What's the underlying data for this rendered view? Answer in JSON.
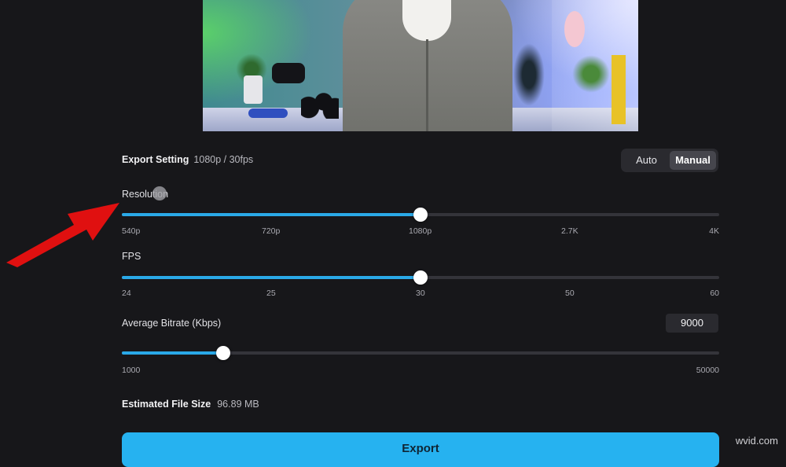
{
  "export_setting": {
    "label": "Export Setting",
    "value": "1080p / 30fps",
    "modes": [
      "Auto",
      "Manual"
    ],
    "active_mode": "Manual"
  },
  "resolution": {
    "label": "Resolution",
    "ticks": [
      "540p",
      "720p",
      "1080p",
      "2.7K",
      "4K"
    ],
    "selected": "1080p",
    "fill_fraction": 0.5
  },
  "fps": {
    "label": "FPS",
    "ticks": [
      "24",
      "25",
      "30",
      "50",
      "60"
    ],
    "selected": "30",
    "fill_fraction": 0.5
  },
  "bitrate": {
    "label": "Average Bitrate (Kbps)",
    "value": "9000",
    "min": "1000",
    "max": "50000",
    "fill_fraction": 0.17
  },
  "file_size": {
    "label": "Estimated File Size",
    "value": "96.89 MB"
  },
  "export_button": {
    "label": "Export"
  },
  "watermark": "wvid.com",
  "colors": {
    "accent": "#2aa9e8",
    "background": "#17171a",
    "arrow": "#e01010"
  }
}
